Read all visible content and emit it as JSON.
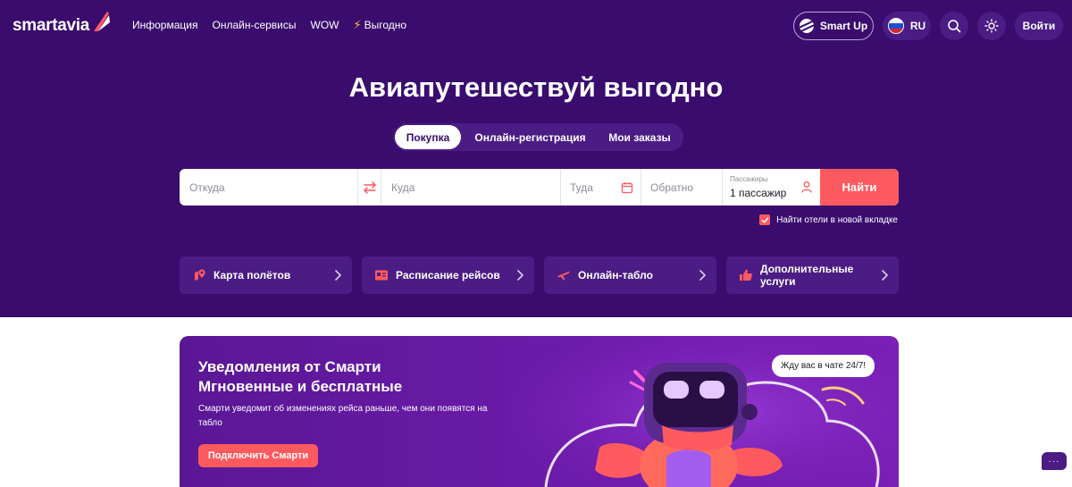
{
  "header": {
    "logo_text": "smartavia",
    "nav": [
      {
        "label": "Информация"
      },
      {
        "label": "Онлайн-сервисы"
      },
      {
        "label": "WOW"
      },
      {
        "label": "Выгодно"
      }
    ],
    "smart_up_label": "Smart Up",
    "lang_label": "RU",
    "login_label": "Войти"
  },
  "hero": {
    "title": "Авиапутешествуй выгодно",
    "tabs": [
      {
        "label": "Покупка",
        "active": true
      },
      {
        "label": "Онлайн-регистрация",
        "active": false
      },
      {
        "label": "Мои заказы",
        "active": false
      }
    ]
  },
  "search": {
    "from_placeholder": "Откуда",
    "to_placeholder": "Куда",
    "depart_placeholder": "Туда",
    "return_placeholder": "Обратно",
    "passengers_label": "Пассажиры",
    "passengers_value": "1 пассажир",
    "submit_label": "Найти",
    "hotels_checkbox_label": "Найти отели в новой вкладке",
    "hotels_checked": true
  },
  "quick_links": [
    {
      "label": "Карта полётов",
      "icon": "map-pin-icon"
    },
    {
      "label": "Расписание рейсов",
      "icon": "schedule-icon"
    },
    {
      "label": "Онлайн-табло",
      "icon": "plane-icon"
    },
    {
      "label": "Дополнительные услуги",
      "icon": "thumbs-up-icon"
    }
  ],
  "promo": {
    "title_line1": "Уведомления от Смарти",
    "title_line2": "Мгновенные и бесплатные",
    "subtitle": "Смарти уведомит об изменениях рейса раньше, чем они появятся на табло",
    "button_label": "Подключить Смарти",
    "bubble_text": "Жду вас в чате 24/7!"
  },
  "chat_fab_label": "···",
  "colors": {
    "hero_bg": "#3a0c6e",
    "card_bg": "#4b1c84",
    "accent": "#ff5a5f"
  }
}
